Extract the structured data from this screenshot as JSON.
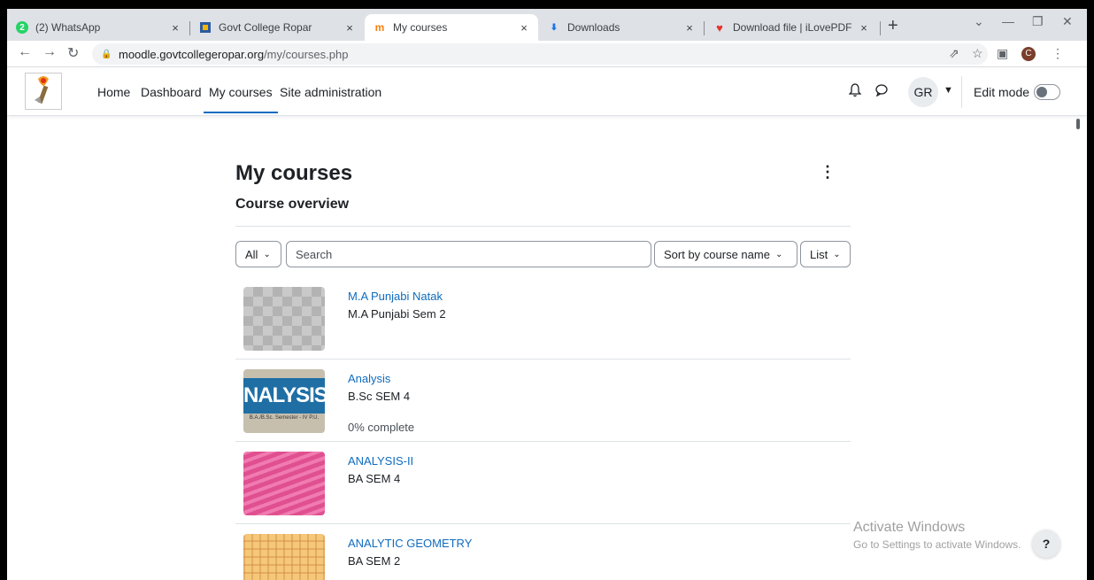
{
  "browser": {
    "tabs": [
      {
        "title": "(2) WhatsApp",
        "icon": "whatsapp-icon",
        "badge": "2"
      },
      {
        "title": "Govt College Ropar",
        "icon": "college-logo-icon"
      },
      {
        "title": "My courses",
        "icon": "moodle-icon",
        "active": true
      },
      {
        "title": "Downloads",
        "icon": "download-icon"
      },
      {
        "title": "Download file | iLovePDF",
        "icon": "ilovepdf-heart-icon"
      }
    ],
    "close_glyph": "×",
    "new_tab": "+",
    "window_controls": {
      "chevron": "⌄",
      "minimize": "—",
      "restore": "❐",
      "close": "✕"
    },
    "url_host": "moodle.govtcollegeropar.org",
    "url_path": "/my/courses.php",
    "profile_initial": "C"
  },
  "nav": {
    "links": [
      "Home",
      "Dashboard",
      "My courses",
      "Site administration"
    ],
    "active": "My courses",
    "user_initials": "GR",
    "edit_mode_label": "Edit mode",
    "edit_mode_on": false
  },
  "page": {
    "title": "My courses",
    "section_title": "Course overview",
    "filter_label": "All",
    "search_placeholder": "Search",
    "sort_label": "Sort by course name",
    "view_label": "List"
  },
  "courses": [
    {
      "name": "M.A Punjabi Natak",
      "category": "M.A Punjabi Sem 2",
      "progress": ""
    },
    {
      "name": "Analysis",
      "category": "B.Sc SEM 4",
      "progress": "0% complete",
      "thumb_text": "NALYSIS-",
      "thumb_sub": "B.A./B.Sc. Semester - IV  P.U."
    },
    {
      "name": "ANALYSIS-II",
      "category": "BA SEM 4",
      "progress": ""
    },
    {
      "name": "ANALYTIC GEOMETRY",
      "category": "BA SEM 2",
      "progress": ""
    }
  ],
  "overlay": {
    "activate_title": "Activate Windows",
    "activate_sub": "Go to Settings to activate Windows.",
    "help": "?"
  },
  "colors": {
    "link": "#0f6cbf",
    "text": "#1d2125",
    "border": "#dee2e6"
  }
}
